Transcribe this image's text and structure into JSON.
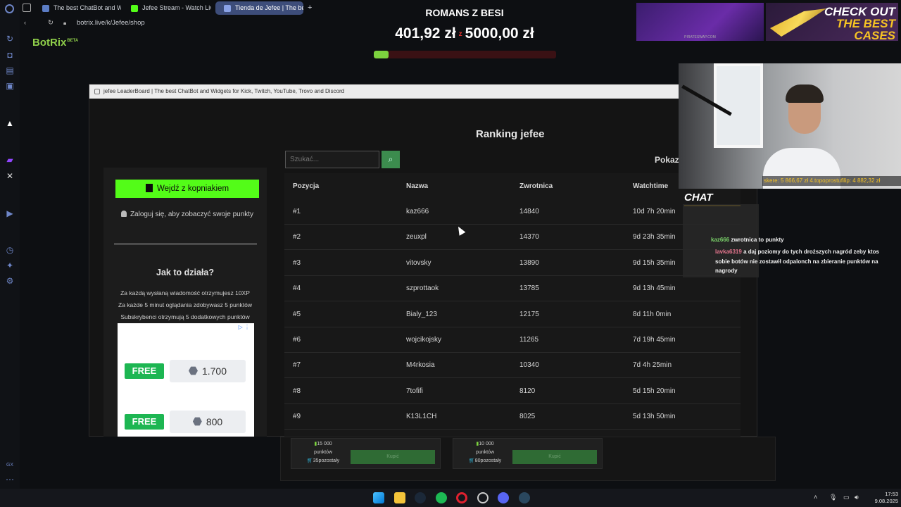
{
  "browser": {
    "tabs": [
      {
        "label": "The best ChatBot and Wi",
        "icon": "botrix-icon",
        "color": "#5b7cc4"
      },
      {
        "label": "Jefee Stream - Watch Liv",
        "icon": "kick-icon",
        "color": "#53fc18"
      },
      {
        "label": "Tienda de Jefee | The bes",
        "icon": "botrix-icon",
        "color": "#8aa2e6"
      }
    ],
    "new_tab": "+",
    "url": "botrix.live/k/Jefee/shop"
  },
  "overlay": {
    "goal_title": "ROMANS Z BESI",
    "goal_current": "401,92 zł",
    "goal_separator": "z",
    "goal_target": "5000,00 zł",
    "goal_progress": 0.08,
    "ad_bottom_text": "PIRATESWAP.COM",
    "ad_right_lines": [
      "CHECK OUT",
      "THE BEST",
      "CASES"
    ],
    "ticker": "skere: 5 866,67 zł  4.topoprostufilip: 4 882,32 zł",
    "chat_logo": "CHAT",
    "chat": [
      {
        "user": "kaz666",
        "text": "zwrotnica to punkty"
      },
      {
        "user": "lavka6319",
        "text": "a daj poziomy do tych droższych nagród zeby ktos sobie botów nie zostawił odpalonch na zbieranie punktów na nagrody"
      }
    ]
  },
  "app": {
    "brand": "BotRix",
    "brand_tag": "BETA",
    "window_title": "jefee LeaderBoard | The best ChatBot and Widgets for Kick, Twitch, YouTube, Trovo and Discord",
    "ranking_title": "Ranking jefee",
    "search_placeholder": "Szukać...",
    "pokaz_label": "Pokaz",
    "kick_login": "Wejdź z kopniakiem",
    "login_prompt": "Zaloguj się, aby zobaczyć swoje punkty",
    "how_title": "Jak to działa?",
    "how_lines": [
      "Za każdą wysłaną wiadomość otrzymujesz 10XP",
      "Za każde 5 minut oglądania zdobywasz 5 punktów",
      "Subskrybenci otrzymują 5 dodatkowych punktów"
    ],
    "ad_offers": [
      {
        "badge": "FREE",
        "amount": "1.700"
      },
      {
        "badge": "FREE",
        "amount": "800"
      }
    ],
    "table": {
      "headers": [
        "Pozycja",
        "Nazwa",
        "Zwrotnica",
        "Watchtime"
      ],
      "rows": [
        [
          "#1",
          "kaz666",
          "14840",
          "10d 7h 20min"
        ],
        [
          "#2",
          "zeuxpl",
          "14370",
          "9d 23h 35min"
        ],
        [
          "#3",
          "vitovsky",
          "13890",
          "9d 15h 35min"
        ],
        [
          "#4",
          "szprottaok",
          "13785",
          "9d 13h 45min"
        ],
        [
          "#5",
          "Bialy_123",
          "12175",
          "8d 11h 0min"
        ],
        [
          "#6",
          "wojcikojsky",
          "11265",
          "7d 19h 45min"
        ],
        [
          "#7",
          "M4rkosia",
          "10340",
          "7d 4h 25min"
        ],
        [
          "#8",
          "7tofifi",
          "8120",
          "5d 15h 20min"
        ],
        [
          "#9",
          "K13L1CH",
          "8025",
          "5d 13h 50min"
        ]
      ]
    },
    "shop": [
      {
        "price": "15 000",
        "unit": "punktów",
        "stock": "35pozostały",
        "buy": "Kupić"
      },
      {
        "price": "10 000",
        "unit": "punktów",
        "stock": "80pozostały",
        "buy": "Kupić"
      }
    ]
  },
  "taskbar": {
    "time": "17:53",
    "date": "9.08.2025"
  }
}
